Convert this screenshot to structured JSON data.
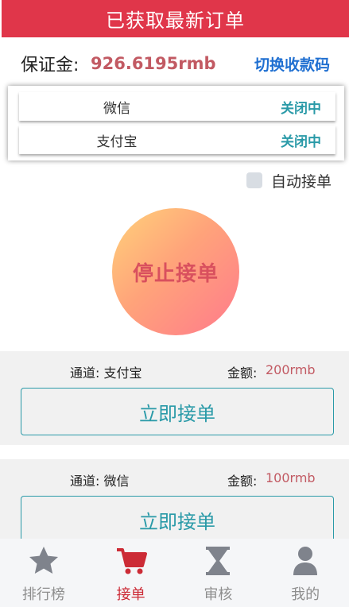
{
  "header": {
    "title": "已获取最新订单"
  },
  "deposit": {
    "label": "保证金:",
    "value": "926.6195rmb",
    "switch_label": "切换收款码"
  },
  "payment_methods": [
    {
      "name": "微信",
      "status": "关闭中"
    },
    {
      "name": "支付宝",
      "status": "关闭中"
    }
  ],
  "auto_accept": {
    "label": "自动接单",
    "checked": false
  },
  "stop_button": {
    "label": "停止接单"
  },
  "orders": [
    {
      "channel_label": "通道:",
      "channel": "支付宝",
      "amount_label": "金额:",
      "amount": "200rmb",
      "button": "立即接单"
    },
    {
      "channel_label": "通道:",
      "channel": "微信",
      "amount_label": "金额:",
      "amount": "100rmb",
      "button": "立即接单"
    }
  ],
  "tabs": [
    {
      "label": "排行榜",
      "icon": "star-icon",
      "active": false
    },
    {
      "label": "接单",
      "icon": "cart-icon",
      "active": true
    },
    {
      "label": "审核",
      "icon": "hourglass-icon",
      "active": false
    },
    {
      "label": "我的",
      "icon": "user-icon",
      "active": false
    }
  ],
  "colors": {
    "header": "#e0364a",
    "accent_teal": "#2a9aa8",
    "amount": "#c25a63",
    "link": "#1f6fd1",
    "tab_active": "#cc2b36",
    "tab_inactive": "#7f838c"
  }
}
